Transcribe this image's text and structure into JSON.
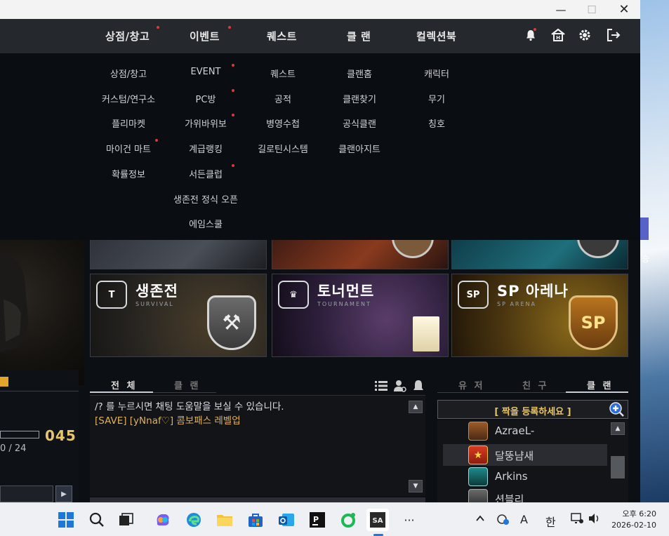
{
  "titlebar": {
    "minimize": "—",
    "maximize": "☐",
    "close": "✕"
  },
  "nav": {
    "items": [
      "상점/창고",
      "이벤트",
      "퀘스트",
      "클 랜",
      "컬렉션북"
    ],
    "icons": [
      "bell-icon",
      "home-icon",
      "gear-icon",
      "logout-icon"
    ]
  },
  "submenu": {
    "col1": [
      "상점/창고",
      "커스텀/연구소",
      "플리마켓",
      "마이건 마트",
      "확률정보"
    ],
    "col2": [
      "EVENT",
      "PC방",
      "가위바위보",
      "계급랭킹",
      "서든클럽",
      "생존전 정식 오픈",
      "에임스쿨"
    ],
    "col3": [
      "퀘스트",
      "공적",
      "병영수첩",
      "길로틴시스템"
    ],
    "col4": [
      "클랜홈",
      "클랜찾기",
      "공식클랜",
      "클랜아지트"
    ],
    "col5": [
      "캐릭터",
      "무기",
      "칭호"
    ]
  },
  "banners": [
    {
      "title": "생존전",
      "sub": "SURVIVAL",
      "badge": "T"
    },
    {
      "title": "토너먼트",
      "sub": "TOURNAMENT",
      "badge": "♛"
    },
    {
      "title": "SP 아레나",
      "sub": "SP ARENA",
      "badge": "SP"
    }
  ],
  "player": {
    "level": "045",
    "exp": "0 / 24"
  },
  "chat": {
    "tabs": [
      "전 체",
      "클 랜"
    ],
    "lines": [
      {
        "text": "/? 를 누르시면 채팅 도움말을 보실 수 있습니다.",
        "color": "#d9dde2"
      },
      {
        "text": "[SAVE] [yNnaf♡] 콤보패스 레벨업",
        "color": "#e0b15a"
      }
    ]
  },
  "social": {
    "tabs": [
      "유 저",
      "친 구",
      "클 랜"
    ],
    "clan_header": "[ 짝을 등록하세요 ]",
    "members": [
      "AzraeL-",
      "달뚱냠새",
      "Arkins",
      "션블리"
    ]
  },
  "taskbar": {
    "tray_lang": "A",
    "tray_ime": "한",
    "time": "오후 6:20",
    "date": "2026-02-10",
    "desktop_label": "승"
  },
  "colors": {
    "accent_gold": "#e0b15a",
    "clan_header": "#e8c56a",
    "notify_dot": "#d83b3b"
  }
}
